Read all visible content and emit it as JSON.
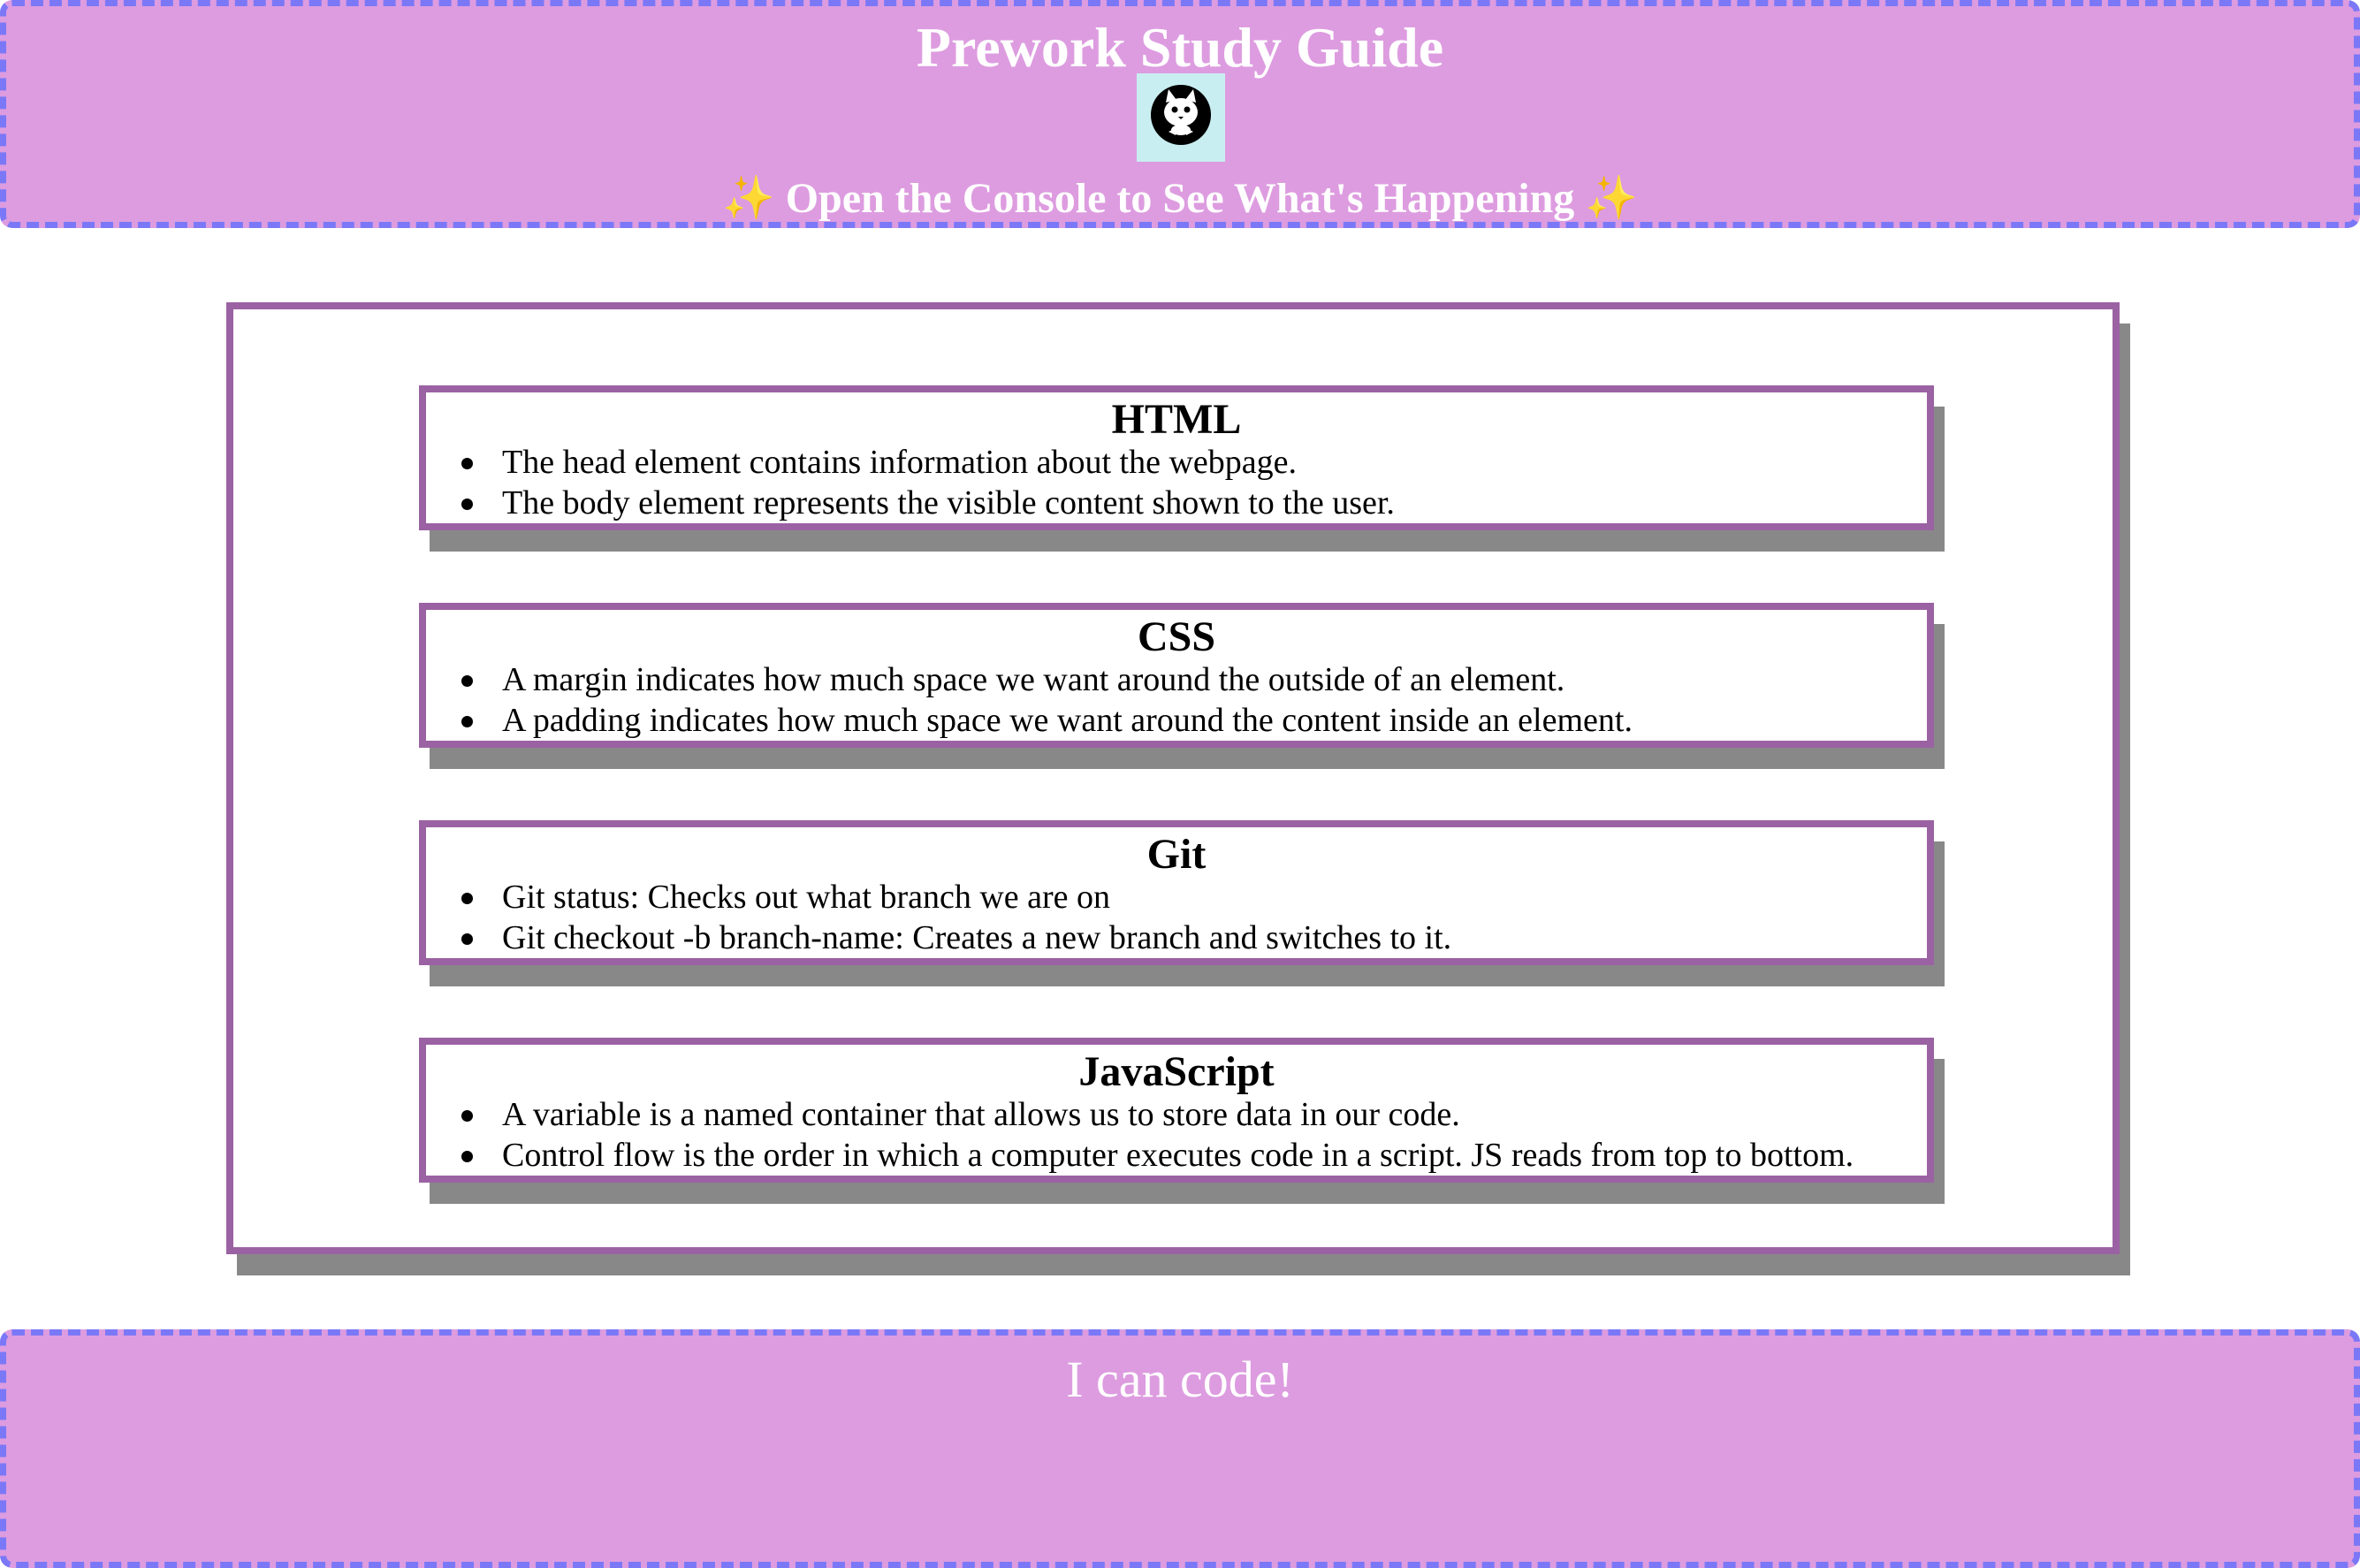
{
  "header": {
    "title": "Prework Study Guide",
    "logo_icon": "cat-logo-icon",
    "subtitle_sparkle_left": "✨",
    "subtitle": "Open the Console to See What's Happening",
    "subtitle_sparkle_right": "✨"
  },
  "sections": [
    {
      "title": "HTML",
      "items": [
        "The head element contains information about the webpage.",
        "The body element represents the visible content shown to the user."
      ]
    },
    {
      "title": "CSS",
      "items": [
        "A margin indicates how much space we want around the outside of an element.",
        "A padding indicates how much space we want around the content inside an element."
      ]
    },
    {
      "title": "Git",
      "items": [
        "Git status: Checks out what branch we are on",
        "Git checkout -b branch-name: Creates a new branch and switches to it."
      ]
    },
    {
      "title": "JavaScript",
      "items": [
        "A variable is a named container that allows us to store data in our code.",
        "Control flow is the order in which a computer executes code in a script. JS reads from top to bottom."
      ]
    }
  ],
  "footer": {
    "text": "I can code!"
  },
  "colors": {
    "banner_background": "#dd9ce0",
    "banner_border": "#7b78f7",
    "card_border": "#9b62a3",
    "card_shadow": "#888888",
    "logo_background": "#c9eef1"
  }
}
